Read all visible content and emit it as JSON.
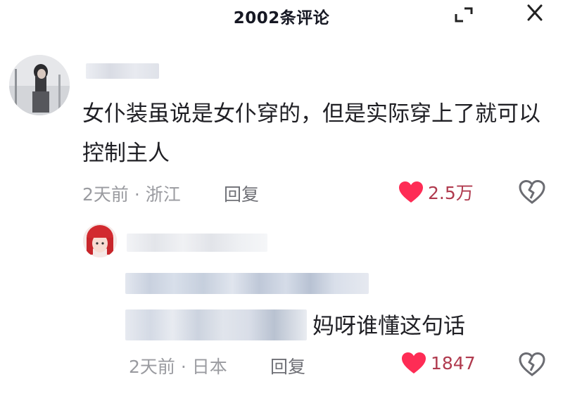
{
  "header": {
    "title": "2002条评论",
    "expand_icon": "expand-icon",
    "close_icon": "close-icon"
  },
  "comments": [
    {
      "text": "女仆装虽说是女仆穿的，但是实际穿上了就可以控制主人",
      "time": "2天前",
      "location": "浙江",
      "reply_label": "回复",
      "likes": "2.5万",
      "like_icon": "heart-filled-icon",
      "dislike_icon": "broken-heart-icon",
      "reply": {
        "text_visible": "妈呀谁懂这句话",
        "time": "2天前",
        "location": "日本",
        "reply_label": "回复",
        "likes": "1847",
        "like_icon": "heart-filled-icon",
        "dislike_icon": "broken-heart-icon"
      }
    }
  ],
  "colors": {
    "heart": "#fe2c55",
    "meta": "#9a9ba0",
    "text": "#1f1f24"
  }
}
